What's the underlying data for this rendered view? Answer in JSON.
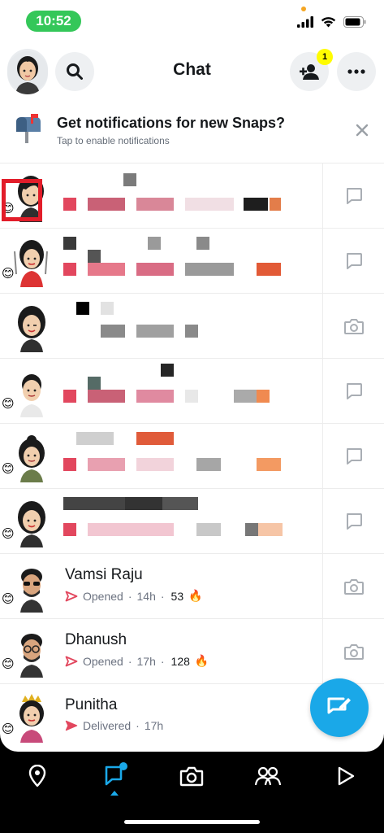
{
  "status_bar": {
    "time": "10:52"
  },
  "header": {
    "title": "Chat",
    "friend_requests_badge": "1"
  },
  "notification_banner": {
    "title": "Get notifications for new Snaps?",
    "subtitle": "Tap to enable notifications"
  },
  "chats": [
    {
      "name": "Vamsi Raju",
      "status": "Opened",
      "time": "14h",
      "streak": "53",
      "action": "camera"
    },
    {
      "name": "Dhanush",
      "status": "Opened",
      "time": "17h",
      "streak": "128",
      "action": "camera"
    },
    {
      "name": "Punitha",
      "status": "Delivered",
      "time": "17h",
      "streak": "",
      "action": "camera"
    }
  ],
  "colors": {
    "accent_blue": "#1aa8e8",
    "snap_red": "#e2475e",
    "badge_yellow": "#fffc00",
    "status_green": "#34c759",
    "highlight_red": "#e21d2a"
  },
  "icons": {
    "emoji_friend": "😊",
    "streak_fire": "🔥"
  }
}
